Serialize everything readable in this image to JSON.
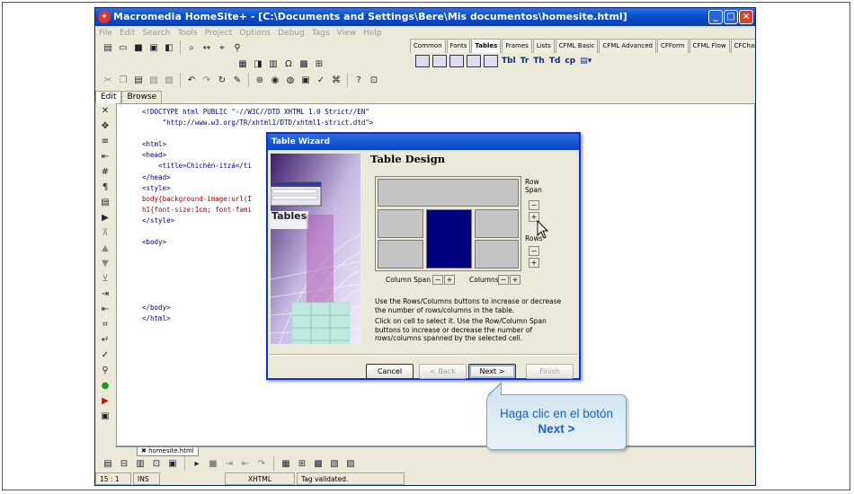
{
  "window": {
    "title": "Macromedia HomeSite+ - [C:\\Documents and Settings\\Bere\\Mis documentos\\homesite.html]",
    "minimize": "_",
    "maximize": "□",
    "close": "×"
  },
  "menu": [
    "File",
    "Edit",
    "Search",
    "Tools",
    "Project",
    "Options",
    "Debug",
    "Tags",
    "View",
    "Help"
  ],
  "tag_tabs": [
    "Common",
    "Fonts",
    "Tables",
    "Frames",
    "Lists",
    "CFML Basic",
    "CFML Advanced",
    "CFForm",
    "CFML Flow",
    "CFChart"
  ],
  "active_tag_tab": "Tables",
  "tag_toolbar": [
    "Tbl",
    "Tr",
    "Th",
    "Td",
    "cp"
  ],
  "edit_tabs": [
    "Edit",
    "Browse"
  ],
  "code_lines": [
    {
      "t": "<!DOCTYPE html PUBLIC \"-//W3C//DTD XHTML 1.0 Strict//EN\"",
      "c": "blue"
    },
    {
      "t": "     \"http://www.w3.org/TR/xhtml1/DTD/xhtml1-strict.dtd\">",
      "c": "blue"
    },
    {
      "t": "",
      "c": "blue"
    },
    {
      "t": "<html>",
      "c": "blue"
    },
    {
      "t": "<head>",
      "c": "blue"
    },
    {
      "t": "    <title>Chichén-itzá</ti",
      "c": "blue"
    },
    {
      "t": "</head>",
      "c": "blue"
    },
    {
      "t": "<style>",
      "c": "blue"
    },
    {
      "t": "body{background-image:url(I",
      "c": "red"
    },
    {
      "t": "h1{font-size:1cm; font-fami",
      "c": "red"
    },
    {
      "t": "</style>",
      "c": "blue"
    },
    {
      "t": "",
      "c": "blue"
    },
    {
      "t": "<body>",
      "c": "blue"
    },
    {
      "t": "",
      "c": "blue"
    },
    {
      "t": "",
      "c": "blue"
    },
    {
      "t": "",
      "c": "blue"
    },
    {
      "t": "",
      "c": "blue"
    },
    {
      "t": "",
      "c": "blue"
    },
    {
      "t": "</body>",
      "c": "blue"
    },
    {
      "t": "</html>",
      "c": "blue"
    }
  ],
  "doc_tab": "homesite.html",
  "status": {
    "position": "15 : 1",
    "mode": "INS",
    "doctype": "XHTML",
    "message": "Tag validated."
  },
  "dialog": {
    "title": "Table Wizard",
    "image_label": "Tables",
    "heading": "Table Design",
    "row_span_label": "Row Span",
    "rows_label": "Rows",
    "column_span_label": "Column Span",
    "columns_label": "Columns",
    "minus": "−",
    "plus": "+",
    "help1": "Use the Rows/Columns buttons to increase or decrease the  number of rows/columns in the table.",
    "help2": "Click on cell to select it. Use the Row/Column Span buttons to increase or decrease the number of rows/columns spanned by the selected cell.",
    "buttons": {
      "cancel": "Cancel",
      "back": "< Back",
      "next": "Next >",
      "finish": "Finish"
    }
  },
  "callout": {
    "line1": "Haga clic en el botón",
    "line2": "Next >"
  },
  "colors": {
    "titlebar": "#0a4fcf",
    "dialog_border": "#0831d9",
    "selected_cell": "#000080",
    "callout_text": "#1f5fc4"
  }
}
